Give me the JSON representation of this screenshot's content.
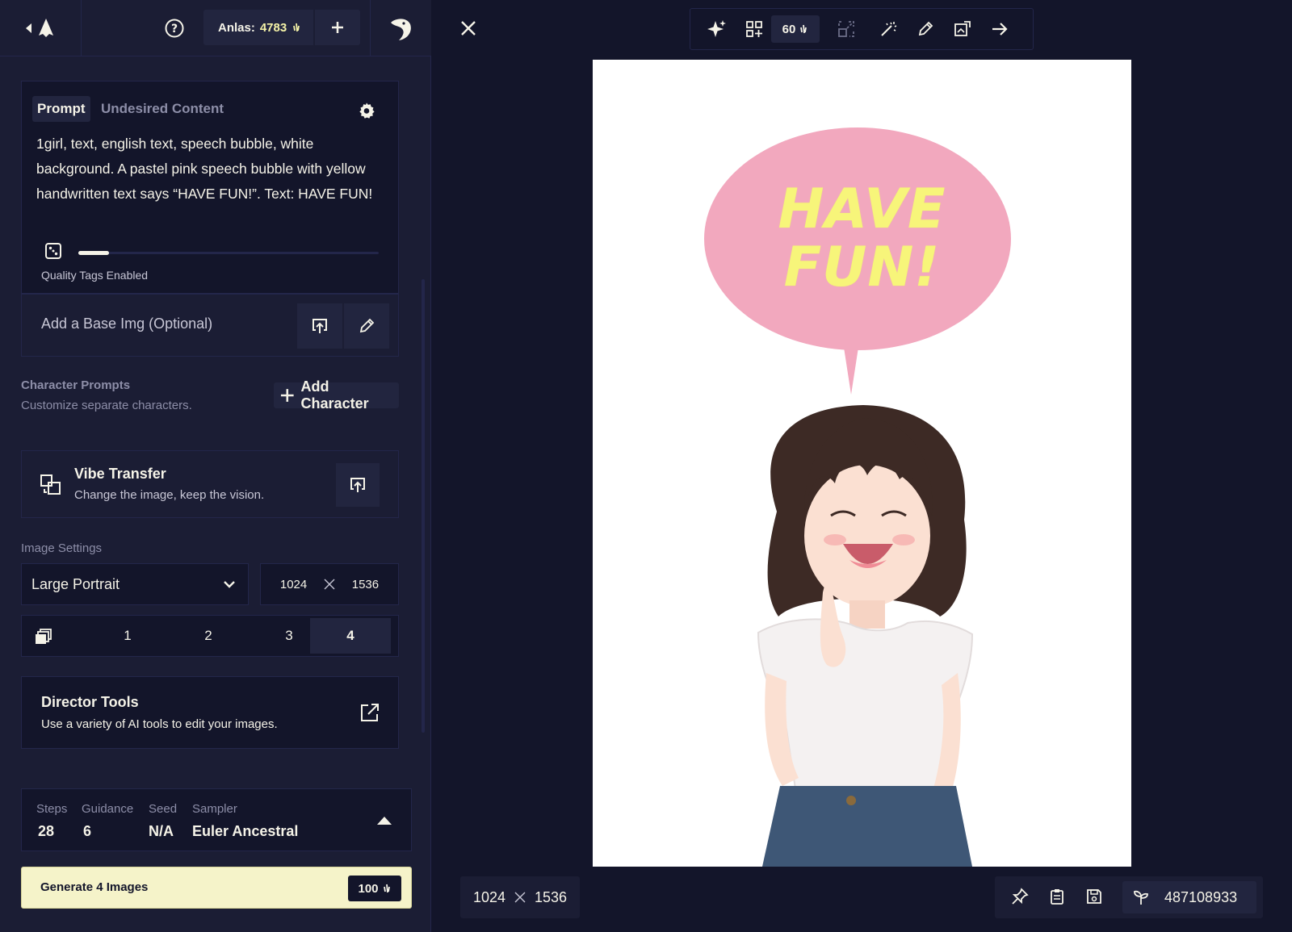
{
  "topbar": {
    "anlas_label": "Anlas:",
    "anlas_value": "4783"
  },
  "prompt": {
    "tabs": [
      "Prompt",
      "Undesired Content"
    ],
    "text": "1girl, text, english text, speech bubble, white background. A pastel pink speech bubble with yellow handwritten text says “HAVE FUN!”. Text: HAVE FUN!",
    "quality_label": "Quality Tags Enabled"
  },
  "base_img": {
    "label": "Add a Base Img (Optional)"
  },
  "characters": {
    "title": "Character Prompts",
    "subtitle": "Customize separate characters.",
    "add_label": "Add Character"
  },
  "vibe": {
    "title": "Vibe Transfer",
    "subtitle": "Change the image, keep the vision."
  },
  "image_settings": {
    "label": "Image Settings",
    "size_preset": "Large Portrait",
    "width": "1024",
    "height": "1536",
    "counts": [
      "1",
      "2",
      "3",
      "4"
    ],
    "selected_count": "4"
  },
  "director": {
    "title": "Director Tools",
    "subtitle": "Use a variety of AI tools to edit your images."
  },
  "params": {
    "steps_label": "Steps",
    "steps": "28",
    "guidance_label": "Guidance",
    "guidance": "6",
    "seed_label": "Seed",
    "seed": "N/A",
    "sampler_label": "Sampler",
    "sampler": "Euler Ancestral"
  },
  "generate": {
    "label": "Generate 4 Images",
    "cost": "100"
  },
  "toolbar": {
    "steps_value": "60"
  },
  "canvas": {
    "bubble_line1": "HAVE",
    "bubble_line2": "FUN!"
  },
  "bottom": {
    "width": "1024",
    "height": "1536",
    "seed": "487108933"
  },
  "colors": {
    "background": "#13152a",
    "panel": "#1b1d34",
    "accent_yellow": "#f5f3a8",
    "generate_bg": "#f5f3c9",
    "bubble_pink": "#f2a8be",
    "bubble_text": "#f7f57a"
  }
}
